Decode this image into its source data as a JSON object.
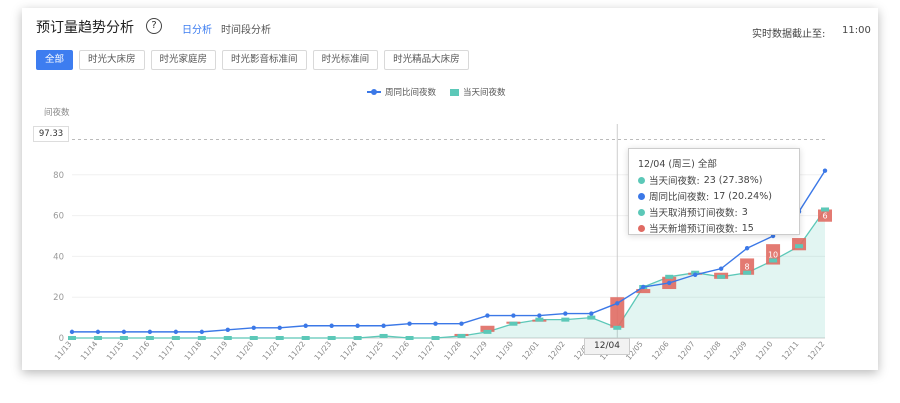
{
  "header": {
    "title": "预订量趋势分析",
    "help_icon": "question-circle-icon",
    "modes": [
      "日分析",
      "时间段分析"
    ],
    "active_mode": "日分析",
    "data_cutoff_label": "实时数据截止至:",
    "data_cutoff_time": "11:00"
  },
  "filters": {
    "items": [
      "全部",
      "时光大床房",
      "时光家庭房",
      "时光影音标准间",
      "时光标准间",
      "时光精品大床房"
    ],
    "active": "全部"
  },
  "chart_data": {
    "type": "line",
    "y_axis_name": "间夜数",
    "y_ticks": [
      "0",
      "20",
      "40",
      "60",
      "80"
    ],
    "ylim": [
      0,
      100
    ],
    "crosshair_value_label": "97.33",
    "x": [
      "11/13",
      "11/14",
      "11/15",
      "11/16",
      "11/17",
      "11/18",
      "11/19",
      "11/20",
      "11/21",
      "11/22",
      "11/23",
      "11/24",
      "11/25",
      "11/26",
      "11/27",
      "11/28",
      "11/29",
      "11/30",
      "12/01",
      "12/02",
      "12/03",
      "12/04",
      "12/05",
      "12/06",
      "12/07",
      "12/08",
      "12/09",
      "12/10",
      "12/11",
      "12/12"
    ],
    "series": [
      {
        "name": "周同比间夜数",
        "color": "#3b78e7",
        "kind": "line",
        "values": [
          3,
          3,
          3,
          3,
          3,
          3,
          4,
          5,
          5,
          6,
          6,
          6,
          6,
          7,
          7,
          7,
          11,
          11,
          11,
          12,
          12,
          17,
          25,
          27,
          31,
          34,
          44,
          50,
          62,
          82
        ]
      },
      {
        "name": "当天间夜数",
        "color": "#5cc8b8",
        "kind": "line-area",
        "values": [
          0,
          0,
          0,
          0,
          0,
          0,
          0,
          0,
          0,
          0,
          0,
          0,
          1,
          0,
          0,
          1,
          3,
          7,
          9,
          9,
          10,
          5,
          25,
          30,
          32,
          30,
          32,
          38,
          45,
          63
        ]
      }
    ],
    "bars": {
      "name": "当天新增预订间夜数",
      "color": "#e06b63",
      "bases": [
        0,
        0,
        0,
        0,
        0,
        0,
        0,
        0,
        0,
        0,
        0,
        0,
        0,
        0,
        0,
        1,
        3,
        7,
        8,
        9,
        10,
        5,
        22,
        24,
        31,
        29,
        31,
        36,
        43,
        57
      ],
      "values": [
        0,
        0,
        0,
        0,
        0,
        0,
        0,
        0,
        0,
        0,
        0,
        0,
        0,
        0,
        0,
        1,
        3,
        1,
        1,
        0,
        0,
        15,
        2,
        6,
        1,
        3,
        8,
        10,
        6,
        6
      ],
      "labels": [
        "",
        "",
        "",
        "",
        "",
        "",
        "",
        "",
        "",
        "",
        "",
        "",
        "",
        "",
        "",
        "",
        "",
        "",
        "",
        "",
        "",
        "",
        "",
        "",
        "",
        "",
        "8",
        "10",
        "",
        "6"
      ]
    },
    "tooltip": {
      "title": "12/04 (周三) 全部",
      "rows": [
        {
          "label": "当天间夜数:",
          "value": "23 (27.38%)",
          "color": "#5cc8b8"
        },
        {
          "label": "周同比间夜数:",
          "value": "17 (20.24%)",
          "color": "#3b78e7"
        },
        {
          "label": "当天取消预订间夜数:",
          "value": "3",
          "color": "#5cc8b8"
        },
        {
          "label": "当天新增预订间夜数:",
          "value": "15",
          "color": "#e06b63"
        }
      ]
    },
    "active_x_label": "12/04"
  }
}
